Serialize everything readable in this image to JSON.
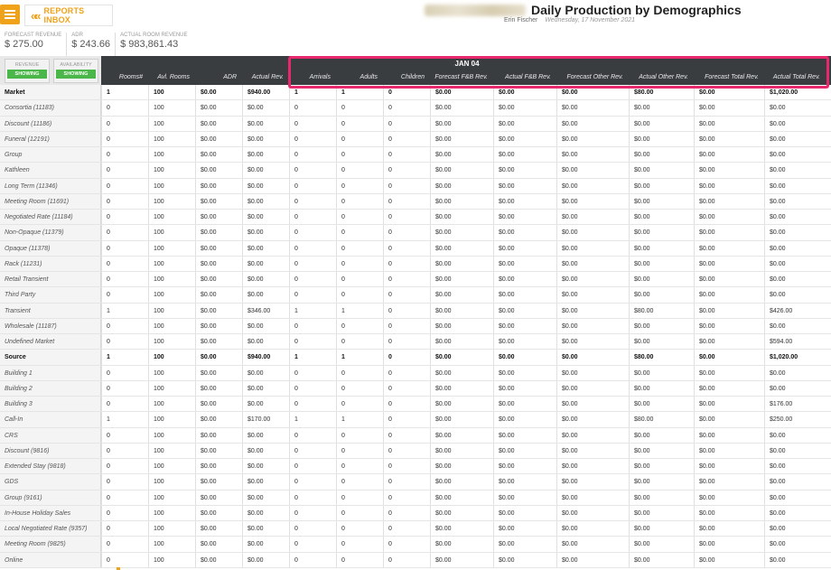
{
  "topbar": {
    "reports_inbox": "REPORTS INBOX",
    "title": "Daily Production by Demographics",
    "user": "Erin Fischer",
    "date": "Wednesday, 17 November 2021"
  },
  "kpis": [
    {
      "label": "FORECAST REVENUE",
      "value": "$ 275.00"
    },
    {
      "label": "ADR",
      "value": "$ 243.66"
    },
    {
      "label": "ACTUAL ROOM REVENUE",
      "value": "$ 983,861.43"
    }
  ],
  "toggles": [
    {
      "label": "REVENUE",
      "state": "SHOWING"
    },
    {
      "label": "AVAILABILITY",
      "state": "SHOWING"
    }
  ],
  "table": {
    "day": "JAN 04",
    "columns": [
      "Rooms#",
      "Avl. Rooms",
      "ADR",
      "Actual Rev.",
      "Arrivals",
      "Adults",
      "Children",
      "Forecast F&B Rev.",
      "Actual F&B Rev.",
      "Forecast Other Rev.",
      "Actual Other Rev.",
      "Forecast Total Rev.",
      "Actual Total Rev."
    ],
    "rows": [
      {
        "label": "Market",
        "bold": true,
        "cells": [
          "1",
          "100",
          "$0.00",
          "$940.00",
          "1",
          "1",
          "0",
          "$0.00",
          "$0.00",
          "$0.00",
          "$80.00",
          "$0.00",
          "$1,020.00"
        ]
      },
      {
        "label": "Consortia (11183)",
        "cells": [
          "0",
          "100",
          "$0.00",
          "$0.00",
          "0",
          "0",
          "0",
          "$0.00",
          "$0.00",
          "$0.00",
          "$0.00",
          "$0.00",
          "$0.00"
        ]
      },
      {
        "label": "Discount (11186)",
        "cells": [
          "0",
          "100",
          "$0.00",
          "$0.00",
          "0",
          "0",
          "0",
          "$0.00",
          "$0.00",
          "$0.00",
          "$0.00",
          "$0.00",
          "$0.00"
        ]
      },
      {
        "label": "Funeral (12191)",
        "cells": [
          "0",
          "100",
          "$0.00",
          "$0.00",
          "0",
          "0",
          "0",
          "$0.00",
          "$0.00",
          "$0.00",
          "$0.00",
          "$0.00",
          "$0.00"
        ]
      },
      {
        "label": "Group",
        "cells": [
          "0",
          "100",
          "$0.00",
          "$0.00",
          "0",
          "0",
          "0",
          "$0.00",
          "$0.00",
          "$0.00",
          "$0.00",
          "$0.00",
          "$0.00"
        ]
      },
      {
        "label": "Kathleen",
        "cells": [
          "0",
          "100",
          "$0.00",
          "$0.00",
          "0",
          "0",
          "0",
          "$0.00",
          "$0.00",
          "$0.00",
          "$0.00",
          "$0.00",
          "$0.00"
        ]
      },
      {
        "label": "Long Term (11346)",
        "cells": [
          "0",
          "100",
          "$0.00",
          "$0.00",
          "0",
          "0",
          "0",
          "$0.00",
          "$0.00",
          "$0.00",
          "$0.00",
          "$0.00",
          "$0.00"
        ]
      },
      {
        "label": "Meeting Room (11691)",
        "cells": [
          "0",
          "100",
          "$0.00",
          "$0.00",
          "0",
          "0",
          "0",
          "$0.00",
          "$0.00",
          "$0.00",
          "$0.00",
          "$0.00",
          "$0.00"
        ]
      },
      {
        "label": "Negotiated Rate (11184)",
        "cells": [
          "0",
          "100",
          "$0.00",
          "$0.00",
          "0",
          "0",
          "0",
          "$0.00",
          "$0.00",
          "$0.00",
          "$0.00",
          "$0.00",
          "$0.00"
        ]
      },
      {
        "label": "Non-Opaque (11379)",
        "cells": [
          "0",
          "100",
          "$0.00",
          "$0.00",
          "0",
          "0",
          "0",
          "$0.00",
          "$0.00",
          "$0.00",
          "$0.00",
          "$0.00",
          "$0.00"
        ]
      },
      {
        "label": "Opaque (11378)",
        "cells": [
          "0",
          "100",
          "$0.00",
          "$0.00",
          "0",
          "0",
          "0",
          "$0.00",
          "$0.00",
          "$0.00",
          "$0.00",
          "$0.00",
          "$0.00"
        ]
      },
      {
        "label": "Rack (11231)",
        "cells": [
          "0",
          "100",
          "$0.00",
          "$0.00",
          "0",
          "0",
          "0",
          "$0.00",
          "$0.00",
          "$0.00",
          "$0.00",
          "$0.00",
          "$0.00"
        ]
      },
      {
        "label": "Retail Transient",
        "cells": [
          "0",
          "100",
          "$0.00",
          "$0.00",
          "0",
          "0",
          "0",
          "$0.00",
          "$0.00",
          "$0.00",
          "$0.00",
          "$0.00",
          "$0.00"
        ]
      },
      {
        "label": "Third Party",
        "cells": [
          "0",
          "100",
          "$0.00",
          "$0.00",
          "0",
          "0",
          "0",
          "$0.00",
          "$0.00",
          "$0.00",
          "$0.00",
          "$0.00",
          "$0.00"
        ]
      },
      {
        "label": "Transient",
        "cells": [
          "1",
          "100",
          "$0.00",
          "$346.00",
          "1",
          "1",
          "0",
          "$0.00",
          "$0.00",
          "$0.00",
          "$80.00",
          "$0.00",
          "$426.00"
        ]
      },
      {
        "label": "Wholesale (11187)",
        "cells": [
          "0",
          "100",
          "$0.00",
          "$0.00",
          "0",
          "0",
          "0",
          "$0.00",
          "$0.00",
          "$0.00",
          "$0.00",
          "$0.00",
          "$0.00"
        ]
      },
      {
        "label": "Undefined Market",
        "cells": [
          "0",
          "100",
          "$0.00",
          "$0.00",
          "0",
          "0",
          "0",
          "$0.00",
          "$0.00",
          "$0.00",
          "$0.00",
          "$0.00",
          "$594.00"
        ]
      },
      {
        "label": "Source",
        "bold": true,
        "cells": [
          "1",
          "100",
          "$0.00",
          "$940.00",
          "1",
          "1",
          "0",
          "$0.00",
          "$0.00",
          "$0.00",
          "$80.00",
          "$0.00",
          "$1,020.00"
        ]
      },
      {
        "label": "Building 1",
        "cells": [
          "0",
          "100",
          "$0.00",
          "$0.00",
          "0",
          "0",
          "0",
          "$0.00",
          "$0.00",
          "$0.00",
          "$0.00",
          "$0.00",
          "$0.00"
        ]
      },
      {
        "label": "Building 2",
        "cells": [
          "0",
          "100",
          "$0.00",
          "$0.00",
          "0",
          "0",
          "0",
          "$0.00",
          "$0.00",
          "$0.00",
          "$0.00",
          "$0.00",
          "$0.00"
        ]
      },
      {
        "label": "Building 3",
        "cells": [
          "0",
          "100",
          "$0.00",
          "$0.00",
          "0",
          "0",
          "0",
          "$0.00",
          "$0.00",
          "$0.00",
          "$0.00",
          "$0.00",
          "$176.00"
        ]
      },
      {
        "label": "Call-In",
        "cells": [
          "1",
          "100",
          "$0.00",
          "$170.00",
          "1",
          "1",
          "0",
          "$0.00",
          "$0.00",
          "$0.00",
          "$80.00",
          "$0.00",
          "$250.00"
        ]
      },
      {
        "label": "CRS",
        "cells": [
          "0",
          "100",
          "$0.00",
          "$0.00",
          "0",
          "0",
          "0",
          "$0.00",
          "$0.00",
          "$0.00",
          "$0.00",
          "$0.00",
          "$0.00"
        ]
      },
      {
        "label": "Discount (9816)",
        "cells": [
          "0",
          "100",
          "$0.00",
          "$0.00",
          "0",
          "0",
          "0",
          "$0.00",
          "$0.00",
          "$0.00",
          "$0.00",
          "$0.00",
          "$0.00"
        ]
      },
      {
        "label": "Extended Stay (9818)",
        "cells": [
          "0",
          "100",
          "$0.00",
          "$0.00",
          "0",
          "0",
          "0",
          "$0.00",
          "$0.00",
          "$0.00",
          "$0.00",
          "$0.00",
          "$0.00"
        ]
      },
      {
        "label": "GDS",
        "cells": [
          "0",
          "100",
          "$0.00",
          "$0.00",
          "0",
          "0",
          "0",
          "$0.00",
          "$0.00",
          "$0.00",
          "$0.00",
          "$0.00",
          "$0.00"
        ]
      },
      {
        "label": "Group (9161)",
        "cells": [
          "0",
          "100",
          "$0.00",
          "$0.00",
          "0",
          "0",
          "0",
          "$0.00",
          "$0.00",
          "$0.00",
          "$0.00",
          "$0.00",
          "$0.00"
        ]
      },
      {
        "label": "In-House Holiday Sales",
        "cells": [
          "0",
          "100",
          "$0.00",
          "$0.00",
          "0",
          "0",
          "0",
          "$0.00",
          "$0.00",
          "$0.00",
          "$0.00",
          "$0.00",
          "$0.00"
        ]
      },
      {
        "label": "Local Negotiated Rate (9357)",
        "cells": [
          "0",
          "100",
          "$0.00",
          "$0.00",
          "0",
          "0",
          "0",
          "$0.00",
          "$0.00",
          "$0.00",
          "$0.00",
          "$0.00",
          "$0.00"
        ]
      },
      {
        "label": "Meeting Room (9825)",
        "cells": [
          "0",
          "100",
          "$0.00",
          "$0.00",
          "0",
          "0",
          "0",
          "$0.00",
          "$0.00",
          "$0.00",
          "$0.00",
          "$0.00",
          "$0.00"
        ]
      },
      {
        "label": "Online",
        "cells": [
          "0",
          "100",
          "$0.00",
          "$0.00",
          "0",
          "0",
          "0",
          "$0.00",
          "$0.00",
          "$0.00",
          "$0.00",
          "$0.00",
          "$0.00"
        ]
      }
    ]
  }
}
